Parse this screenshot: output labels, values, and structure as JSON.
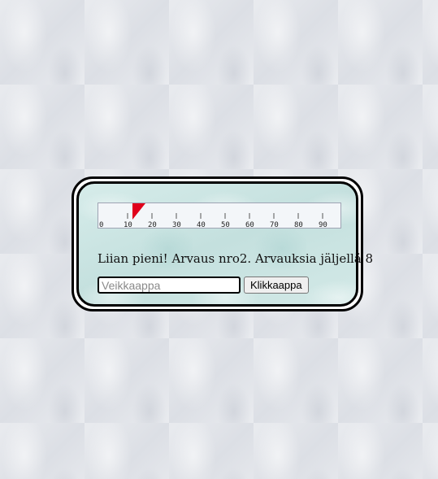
{
  "ruler": {
    "labels": [
      "0",
      "10",
      "20",
      "30",
      "40",
      "50",
      "60",
      "70",
      "80",
      "90"
    ],
    "marker_value": 14,
    "marker_color": "#e0001b"
  },
  "status": {
    "message": "Liian pieni! Arvaus nro2. Arvauksia jäljellä 8"
  },
  "guess_input": {
    "placeholder": "Veikkaappa",
    "value": ""
  },
  "submit_button": {
    "label": "Klikkaappa"
  }
}
